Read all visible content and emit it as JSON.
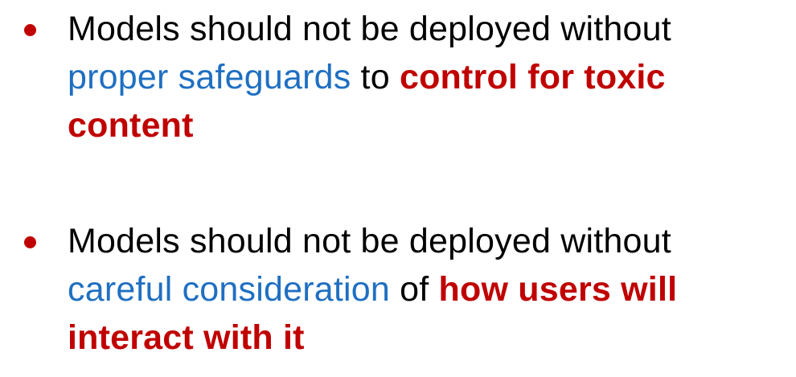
{
  "bullets": [
    {
      "segments": [
        {
          "text": "Models should not be deployed without",
          "style": "plain"
        },
        {
          "text": "proper safeguards",
          "style": "blue"
        },
        {
          "text": " to ",
          "style": "plain"
        },
        {
          "text": "control for toxic",
          "style": "red"
        },
        {
          "text": "content",
          "style": "red"
        }
      ]
    },
    {
      "segments": [
        {
          "text": "Models should not be deployed without",
          "style": "plain"
        },
        {
          "text": "careful consideration",
          "style": "blue"
        },
        {
          "text": " of ",
          "style": "plain"
        },
        {
          "text": "how users will",
          "style": "red"
        },
        {
          "text": "interact with it",
          "style": "red"
        }
      ]
    }
  ],
  "colors": {
    "plain": "#000000",
    "blue": "#1f6fc2",
    "red": "#c00000",
    "bullet": "#c00000"
  }
}
